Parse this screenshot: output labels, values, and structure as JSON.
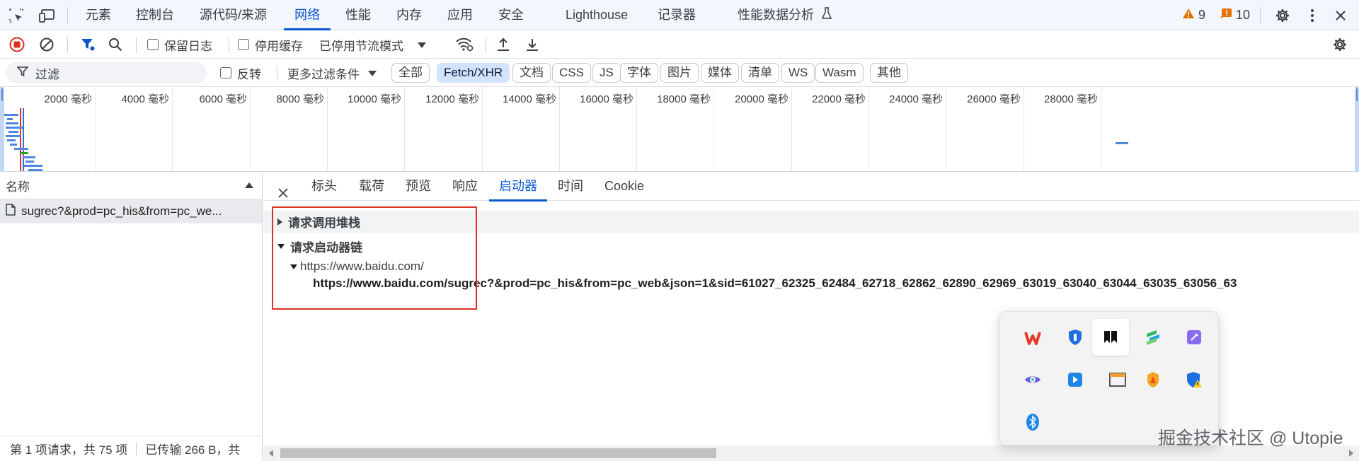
{
  "main_tabs": [
    {
      "label": "元素"
    },
    {
      "label": "控制台"
    },
    {
      "label": "源代码/来源"
    },
    {
      "label": "网络"
    },
    {
      "label": "性能"
    },
    {
      "label": "内存"
    },
    {
      "label": "应用"
    },
    {
      "label": "安全"
    },
    {
      "label": "Lighthouse"
    },
    {
      "label": "记录器"
    },
    {
      "label": "性能数据分析"
    }
  ],
  "active_main_tab": "网络",
  "badges": {
    "warnings": "9",
    "errors": "10"
  },
  "toolbar": {
    "preserve_log": "保留日志",
    "disable_cache": "停用缓存",
    "throttling": "已停用节流模式"
  },
  "filter": {
    "placeholder": "过滤",
    "invert": "反转",
    "more_filters": "更多过滤条件",
    "types": [
      "全部",
      "Fetch/XHR",
      "文档",
      "CSS",
      "JS",
      "字体",
      "图片",
      "媒体",
      "清单",
      "WS",
      "Wasm",
      "其他"
    ],
    "active_type": "Fetch/XHR"
  },
  "timeline": {
    "unit": "毫秒",
    "ticks": [
      "2000 毫秒",
      "4000 毫秒",
      "6000 毫秒",
      "8000 毫秒",
      "10000 毫秒",
      "12000 毫秒",
      "14000 毫秒",
      "16000 毫秒",
      "18000 毫秒",
      "20000 毫秒",
      "22000 毫秒",
      "24000 毫秒",
      "26000 毫秒",
      "28000 毫秒"
    ]
  },
  "requests": {
    "column_name": "名称",
    "rows": [
      {
        "name": "sugrec?&prod=pc_his&from=pc_we..."
      }
    ],
    "status": "第 1 项请求，共 75 项",
    "transferred": "已传输 266 B，共"
  },
  "detail_tabs": [
    {
      "label": "标头"
    },
    {
      "label": "载荷"
    },
    {
      "label": "预览"
    },
    {
      "label": "响应"
    },
    {
      "label": "启动器"
    },
    {
      "label": "时间"
    },
    {
      "label": "Cookie"
    }
  ],
  "active_detail_tab": "启动器",
  "initiator": {
    "call_stack_title": "请求调用堆栈",
    "chain_title": "请求启动器链",
    "chain_root": "https://www.baidu.com/",
    "chain_child": "https://www.baidu.com/sugrec?&prod=pc_his&from=pc_web&json=1&sid=61027_62325_62484_62718_62862_62890_62969_63019_63040_63044_63035_63056_63"
  },
  "tray_icons": [
    "wps-icon",
    "shield-blue-icon",
    "bookmark-app-icon",
    "stacked-app-icon",
    "note-app-icon",
    "eye-app-icon",
    "arrow-app-icon",
    "window-app-icon",
    "fire-app-icon",
    "security-warning-icon",
    "bluetooth-icon"
  ],
  "watermark": "掘金技术社区 @ Utopie",
  "colors": {
    "accent": "#0b57d0",
    "record": "#d93025",
    "highlight_box": "#d93025",
    "warning": "#e37400",
    "error_badge": "#e8710a"
  }
}
